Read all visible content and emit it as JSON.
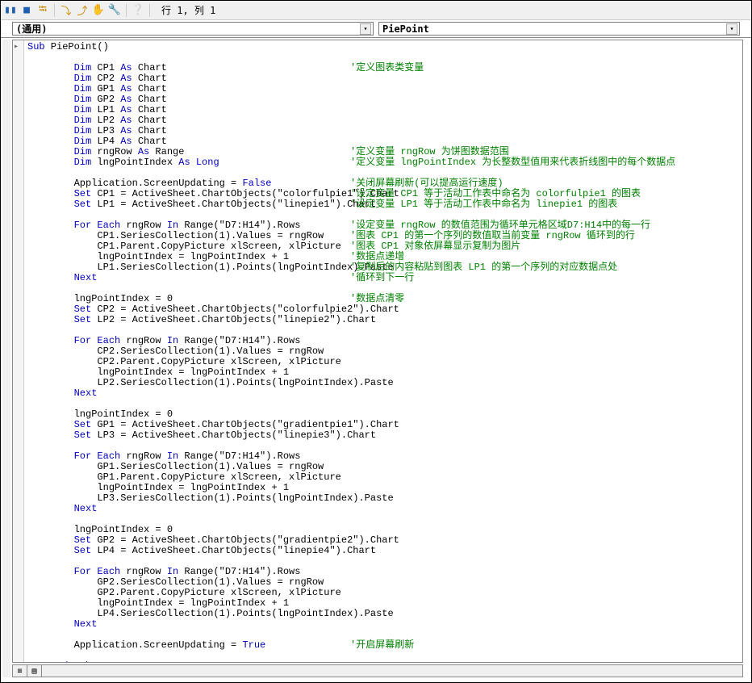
{
  "toolbar": {
    "status": "行 1, 列 1"
  },
  "dropdowns": {
    "left": "(通用)",
    "right": "PiePoint"
  },
  "code": {
    "lines": [
      {
        "i": 0,
        "t": [
          [
            "kw",
            "Sub"
          ],
          [
            "",
            " PiePoint()"
          ]
        ]
      },
      {
        "i": 0,
        "t": [
          [
            "",
            ""
          ]
        ]
      },
      {
        "i": 1,
        "t": [
          [
            "kw",
            "Dim"
          ],
          [
            "",
            " CP1 "
          ],
          [
            "kw",
            "As"
          ],
          [
            "",
            " Chart"
          ]
        ],
        "c": "'定义图表类变量"
      },
      {
        "i": 1,
        "t": [
          [
            "kw",
            "Dim"
          ],
          [
            "",
            " CP2 "
          ],
          [
            "kw",
            "As"
          ],
          [
            "",
            " Chart"
          ]
        ]
      },
      {
        "i": 1,
        "t": [
          [
            "kw",
            "Dim"
          ],
          [
            "",
            " GP1 "
          ],
          [
            "kw",
            "As"
          ],
          [
            "",
            " Chart"
          ]
        ]
      },
      {
        "i": 1,
        "t": [
          [
            "kw",
            "Dim"
          ],
          [
            "",
            " GP2 "
          ],
          [
            "kw",
            "As"
          ],
          [
            "",
            " Chart"
          ]
        ]
      },
      {
        "i": 1,
        "t": [
          [
            "kw",
            "Dim"
          ],
          [
            "",
            " LP1 "
          ],
          [
            "kw",
            "As"
          ],
          [
            "",
            " Chart"
          ]
        ]
      },
      {
        "i": 1,
        "t": [
          [
            "kw",
            "Dim"
          ],
          [
            "",
            " LP2 "
          ],
          [
            "kw",
            "As"
          ],
          [
            "",
            " Chart"
          ]
        ]
      },
      {
        "i": 1,
        "t": [
          [
            "kw",
            "Dim"
          ],
          [
            "",
            " LP3 "
          ],
          [
            "kw",
            "As"
          ],
          [
            "",
            " Chart"
          ]
        ]
      },
      {
        "i": 1,
        "t": [
          [
            "kw",
            "Dim"
          ],
          [
            "",
            " LP4 "
          ],
          [
            "kw",
            "As"
          ],
          [
            "",
            " Chart"
          ]
        ]
      },
      {
        "i": 1,
        "t": [
          [
            "kw",
            "Dim"
          ],
          [
            "",
            " rngRow "
          ],
          [
            "kw",
            "As"
          ],
          [
            "",
            " Range"
          ]
        ],
        "c": "'定义变量 rngRow 为饼图数据范围"
      },
      {
        "i": 1,
        "t": [
          [
            "kw",
            "Dim"
          ],
          [
            "",
            " lngPointIndex "
          ],
          [
            "kw",
            "As Long"
          ]
        ],
        "c": "'定义变量 lngPointIndex 为长整数型值用来代表折线图中的每个数据点"
      },
      {
        "i": 0,
        "t": [
          [
            "",
            ""
          ]
        ]
      },
      {
        "i": 1,
        "t": [
          [
            "",
            "Application.ScreenUpdating = "
          ],
          [
            "kw",
            "False"
          ]
        ],
        "c": "'关闭屏幕刷新(可以提高运行速度)"
      },
      {
        "i": 1,
        "t": [
          [
            "kw",
            "Set"
          ],
          [
            "",
            " CP1 = ActiveSheet.ChartObjects(\"colorfulpie1\").Chart"
          ]
        ],
        "c": "'设定变量 CP1 等于活动工作表中命名为 colorfulpie1 的图表"
      },
      {
        "i": 1,
        "t": [
          [
            "kw",
            "Set"
          ],
          [
            "",
            " LP1 = ActiveSheet.ChartObjects(\"linepie1\").Chart"
          ]
        ],
        "c": "'设定变量 LP1 等于活动工作表中命名为 linepie1 的图表"
      },
      {
        "i": 0,
        "t": [
          [
            "",
            ""
          ]
        ]
      },
      {
        "i": 1,
        "t": [
          [
            "kw",
            "For Each"
          ],
          [
            "",
            " rngRow "
          ],
          [
            "kw",
            "In"
          ],
          [
            "",
            " Range(\"D7:H14\").Rows"
          ]
        ],
        "c": "'设定变量 rngRow 的数值范围为循环单元格区域D7:H14中的每一行"
      },
      {
        "i": 2,
        "t": [
          [
            "",
            "CP1.SeriesCollection(1).Values = rngRow"
          ]
        ],
        "c": "'图表 CP1 的第一个序列的数值取当前变量 rngRow 循环到的行"
      },
      {
        "i": 2,
        "t": [
          [
            "",
            "CP1.Parent.CopyPicture xlScreen, xlPicture"
          ]
        ],
        "c": "'图表 CP1 对象依屏幕显示复制为图片"
      },
      {
        "i": 2,
        "t": [
          [
            "",
            "lngPointIndex = lngPointIndex + 1"
          ]
        ],
        "c": "'数据点递增"
      },
      {
        "i": 2,
        "t": [
          [
            "",
            "LP1.SeriesCollection(1).Points(lngPointIndex).Paste"
          ]
        ],
        "c": "'复制后的内容粘贴到图表 LP1 的第一个序列的对应数据点处"
      },
      {
        "i": 1,
        "t": [
          [
            "kw",
            "Next"
          ]
        ],
        "c": "'循环到下一行"
      },
      {
        "i": 0,
        "t": [
          [
            "",
            ""
          ]
        ]
      },
      {
        "i": 1,
        "t": [
          [
            "",
            "lngPointIndex = 0"
          ]
        ],
        "c": "'数据点清零"
      },
      {
        "i": 1,
        "t": [
          [
            "kw",
            "Set"
          ],
          [
            "",
            " CP2 = ActiveSheet.ChartObjects(\"colorfulpie2\").Chart"
          ]
        ]
      },
      {
        "i": 1,
        "t": [
          [
            "kw",
            "Set"
          ],
          [
            "",
            " LP2 = ActiveSheet.ChartObjects(\"linepie2\").Chart"
          ]
        ]
      },
      {
        "i": 0,
        "t": [
          [
            "",
            ""
          ]
        ]
      },
      {
        "i": 1,
        "t": [
          [
            "kw",
            "For Each"
          ],
          [
            "",
            " rngRow "
          ],
          [
            "kw",
            "In"
          ],
          [
            "",
            " Range(\"D7:H14\").Rows"
          ]
        ]
      },
      {
        "i": 2,
        "t": [
          [
            "",
            "CP2.SeriesCollection(1).Values = rngRow"
          ]
        ]
      },
      {
        "i": 2,
        "t": [
          [
            "",
            "CP2.Parent.CopyPicture xlScreen, xlPicture"
          ]
        ]
      },
      {
        "i": 2,
        "t": [
          [
            "",
            "lngPointIndex = lngPointIndex + 1"
          ]
        ]
      },
      {
        "i": 2,
        "t": [
          [
            "",
            "LP2.SeriesCollection(1).Points(lngPointIndex).Paste"
          ]
        ]
      },
      {
        "i": 1,
        "t": [
          [
            "kw",
            "Next"
          ]
        ]
      },
      {
        "i": 0,
        "t": [
          [
            "",
            ""
          ]
        ]
      },
      {
        "i": 1,
        "t": [
          [
            "",
            "lngPointIndex = 0"
          ]
        ]
      },
      {
        "i": 1,
        "t": [
          [
            "kw",
            "Set"
          ],
          [
            "",
            " GP1 = ActiveSheet.ChartObjects(\"gradientpie1\").Chart"
          ]
        ]
      },
      {
        "i": 1,
        "t": [
          [
            "kw",
            "Set"
          ],
          [
            "",
            " LP3 = ActiveSheet.ChartObjects(\"linepie3\").Chart"
          ]
        ]
      },
      {
        "i": 0,
        "t": [
          [
            "",
            ""
          ]
        ]
      },
      {
        "i": 1,
        "t": [
          [
            "kw",
            "For Each"
          ],
          [
            "",
            " rngRow "
          ],
          [
            "kw",
            "In"
          ],
          [
            "",
            " Range(\"D7:H14\").Rows"
          ]
        ]
      },
      {
        "i": 2,
        "t": [
          [
            "",
            "GP1.SeriesCollection(1).Values = rngRow"
          ]
        ]
      },
      {
        "i": 2,
        "t": [
          [
            "",
            "GP1.Parent.CopyPicture xlScreen, xlPicture"
          ]
        ]
      },
      {
        "i": 2,
        "t": [
          [
            "",
            "lngPointIndex = lngPointIndex + 1"
          ]
        ]
      },
      {
        "i": 2,
        "t": [
          [
            "",
            "LP3.SeriesCollection(1).Points(lngPointIndex).Paste"
          ]
        ]
      },
      {
        "i": 1,
        "t": [
          [
            "kw",
            "Next"
          ]
        ]
      },
      {
        "i": 0,
        "t": [
          [
            "",
            ""
          ]
        ]
      },
      {
        "i": 1,
        "t": [
          [
            "",
            "lngPointIndex = 0"
          ]
        ]
      },
      {
        "i": 1,
        "t": [
          [
            "kw",
            "Set"
          ],
          [
            "",
            " GP2 = ActiveSheet.ChartObjects(\"gradientpie2\").Chart"
          ]
        ]
      },
      {
        "i": 1,
        "t": [
          [
            "kw",
            "Set"
          ],
          [
            "",
            " LP4 = ActiveSheet.ChartObjects(\"linepie4\").Chart"
          ]
        ]
      },
      {
        "i": 0,
        "t": [
          [
            "",
            ""
          ]
        ]
      },
      {
        "i": 1,
        "t": [
          [
            "kw",
            "For Each"
          ],
          [
            "",
            " rngRow "
          ],
          [
            "kw",
            "In"
          ],
          [
            "",
            " Range(\"D7:H14\").Rows"
          ]
        ]
      },
      {
        "i": 2,
        "t": [
          [
            "",
            "GP2.SeriesCollection(1).Values = rngRow"
          ]
        ]
      },
      {
        "i": 2,
        "t": [
          [
            "",
            "GP2.Parent.CopyPicture xlScreen, xlPicture"
          ]
        ]
      },
      {
        "i": 2,
        "t": [
          [
            "",
            "lngPointIndex = lngPointIndex + 1"
          ]
        ]
      },
      {
        "i": 2,
        "t": [
          [
            "",
            "LP4.SeriesCollection(1).Points(lngPointIndex).Paste"
          ]
        ]
      },
      {
        "i": 1,
        "t": [
          [
            "kw",
            "Next"
          ]
        ]
      },
      {
        "i": 0,
        "t": [
          [
            "",
            ""
          ]
        ]
      },
      {
        "i": 1,
        "t": [
          [
            "",
            "Application.ScreenUpdating = "
          ],
          [
            "kw",
            "True"
          ]
        ],
        "c": "'开启屏幕刷新"
      },
      {
        "i": 0,
        "t": [
          [
            "",
            ""
          ]
        ]
      },
      {
        "i": 0,
        "t": [
          [
            "kw",
            "End Sub"
          ]
        ]
      }
    ]
  }
}
